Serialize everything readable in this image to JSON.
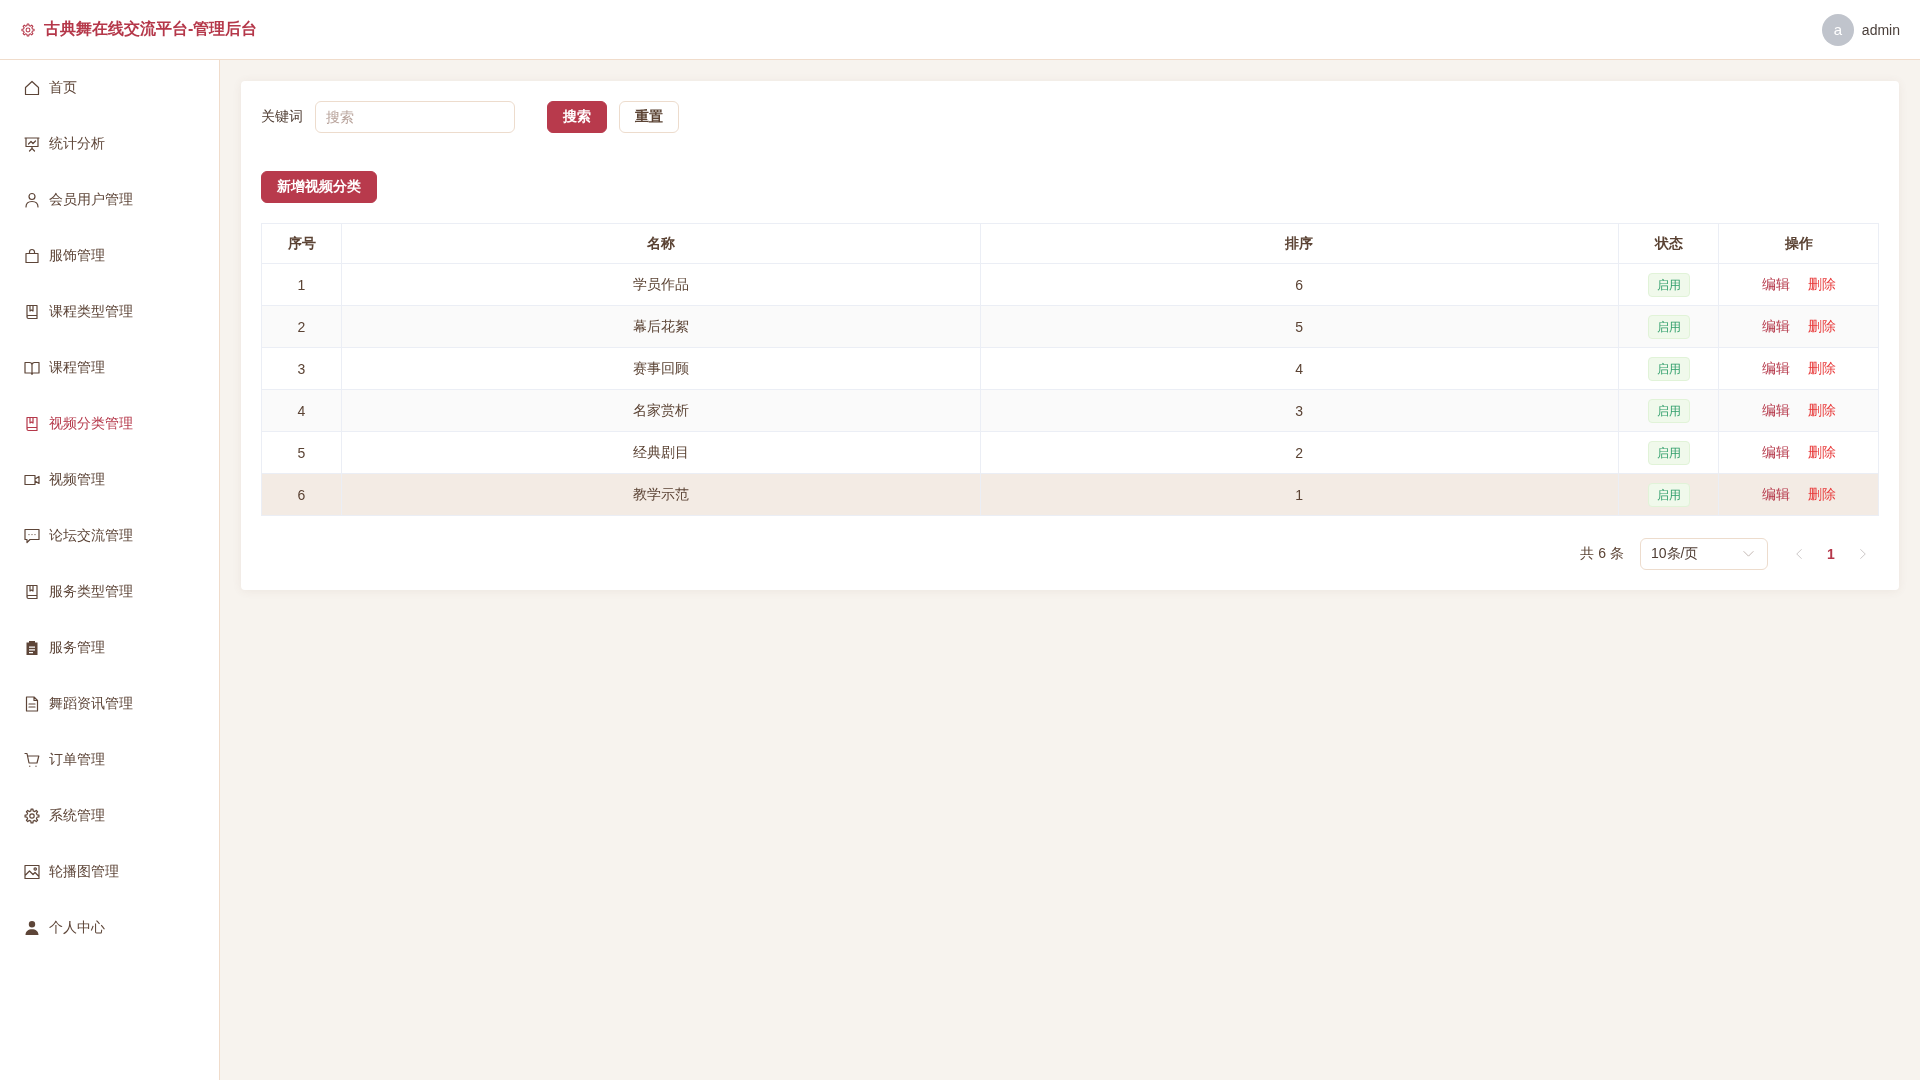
{
  "header": {
    "title": "古典舞在线交流平台-管理后台",
    "user": {
      "avatar_letter": "a",
      "name": "admin"
    }
  },
  "sidebar": {
    "items": [
      {
        "label": "首页",
        "selected": false
      },
      {
        "label": "统计分析",
        "selected": false
      },
      {
        "label": "会员用户管理",
        "selected": false
      },
      {
        "label": "服饰管理",
        "selected": false
      },
      {
        "label": "课程类型管理",
        "selected": false
      },
      {
        "label": "课程管理",
        "selected": false
      },
      {
        "label": "视频分类管理",
        "selected": true
      },
      {
        "label": "视频管理",
        "selected": false
      },
      {
        "label": "论坛交流管理",
        "selected": false
      },
      {
        "label": "服务类型管理",
        "selected": false
      },
      {
        "label": "服务管理",
        "selected": false
      },
      {
        "label": "舞蹈资讯管理",
        "selected": false
      },
      {
        "label": "订单管理",
        "selected": false
      },
      {
        "label": "系统管理",
        "selected": false
      },
      {
        "label": "轮播图管理",
        "selected": false
      },
      {
        "label": "个人中心",
        "selected": false
      }
    ]
  },
  "search": {
    "label": "关键词",
    "placeholder": "搜索",
    "buttons": [
      {
        "label": "搜索",
        "kind": "search"
      },
      {
        "label": "重置",
        "kind": "reset"
      }
    ]
  },
  "add_button": "新增视频分类",
  "table": {
    "columns": [
      "序号",
      "名称",
      "排序",
      "状态",
      "操作"
    ],
    "rows": [
      {
        "cells": [
          "1",
          "学员作品",
          "6"
        ],
        "status": "启用",
        "actions": [
          {
            "label": "编辑",
            "kind": "edit"
          },
          {
            "label": "删除",
            "kind": "delete"
          }
        ],
        "highlighted": false
      },
      {
        "cells": [
          "2",
          "幕后花絮",
          "5"
        ],
        "status": "启用",
        "actions": [
          {
            "label": "编辑",
            "kind": "edit"
          },
          {
            "label": "删除",
            "kind": "delete"
          }
        ],
        "highlighted": false
      },
      {
        "cells": [
          "3",
          "赛事回顾",
          "4"
        ],
        "status": "启用",
        "actions": [
          {
            "label": "编辑",
            "kind": "edit"
          },
          {
            "label": "删除",
            "kind": "delete"
          }
        ],
        "highlighted": false
      },
      {
        "cells": [
          "4",
          "名家赏析",
          "3"
        ],
        "status": "启用",
        "actions": [
          {
            "label": "编辑",
            "kind": "edit"
          },
          {
            "label": "删除",
            "kind": "delete"
          }
        ],
        "highlighted": false
      },
      {
        "cells": [
          "5",
          "经典剧目",
          "2"
        ],
        "status": "启用",
        "actions": [
          {
            "label": "编辑",
            "kind": "edit"
          },
          {
            "label": "删除",
            "kind": "delete"
          }
        ],
        "highlighted": false
      },
      {
        "cells": [
          "6",
          "教学示范",
          "1"
        ],
        "status": "启用",
        "actions": [
          {
            "label": "编辑",
            "kind": "edit"
          },
          {
            "label": "删除",
            "kind": "delete"
          }
        ],
        "highlighted": true
      }
    ]
  },
  "pagination": {
    "total": "共 6 条",
    "page_size": "10条/页",
    "pages": [
      {
        "label": "1",
        "selected": true
      }
    ]
  }
}
